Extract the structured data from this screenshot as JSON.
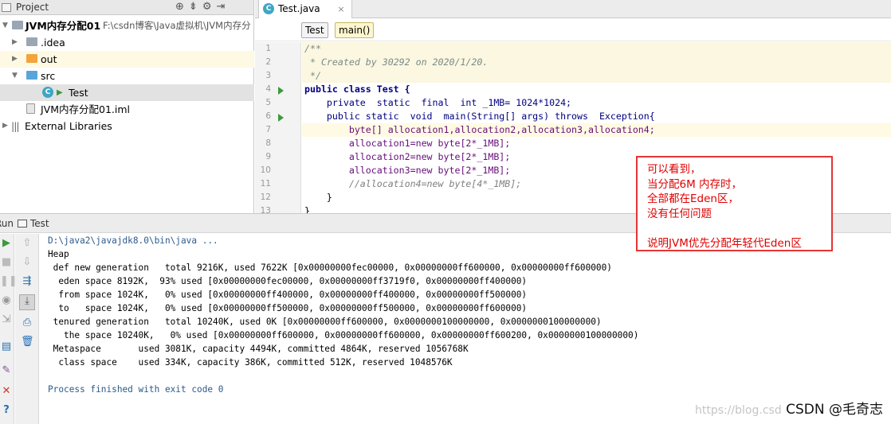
{
  "project_panel": {
    "title": "Project",
    "tree": [
      {
        "label": "JVM内存分配01",
        "path": "F:\\csdn博客\\Java虚拟机\\JVM内存分"
      },
      {
        "label": ".idea"
      },
      {
        "label": "out"
      },
      {
        "label": "src"
      },
      {
        "label": "Test"
      },
      {
        "label": "JVM内存分配01.iml"
      },
      {
        "label": "External Libraries"
      }
    ]
  },
  "editor": {
    "tab": {
      "label": "Test.java"
    },
    "breadcrumbs": [
      "Test",
      "main()"
    ],
    "line_numbers": [
      "1",
      "2",
      "3",
      "4",
      "5",
      "6",
      "7",
      "8",
      "9",
      "10",
      "11",
      "12",
      "13"
    ],
    "lines": [
      "/**",
      " * Created by 30292 on 2020/1/20.",
      " */",
      "public class Test {",
      "    private  static  final  int _1MB= 1024*1024;",
      "    public static  void  main(String[] args) throws  Exception{",
      "        byte[] allocation1,allocation2,allocation3,allocation4;",
      "        allocation1=new byte[2*_1MB];",
      "        allocation2=new byte[2*_1MB];",
      "        allocation3=new byte[2*_1MB];",
      "        //allocation4=new byte[4*_1MB];",
      "    }",
      "}"
    ]
  },
  "annotation": {
    "lines": [
      "可以看到，",
      "当分配6M 内存时，",
      "全部都在Eden区，",
      "没有任何问题",
      "",
      "说明JVM优先分配年轻代Eden区"
    ]
  },
  "run_panel": {
    "label": "Run",
    "tab": "Test"
  },
  "console": {
    "lines": [
      "D:\\java2\\javajdk8.0\\bin\\java ...",
      "Heap",
      " def new generation   total 9216K, used 7622K [0x00000000fec00000, 0x00000000ff600000, 0x00000000ff600000)",
      "  eden space 8192K,  93% used [0x00000000fec00000, 0x00000000ff3719f0, 0x00000000ff400000)",
      "  from space 1024K,   0% used [0x00000000ff400000, 0x00000000ff400000, 0x00000000ff500000)",
      "  to   space 1024K,   0% used [0x00000000ff500000, 0x00000000ff500000, 0x00000000ff600000)",
      " tenured generation   total 10240K, used 0K [0x00000000ff600000, 0x0000000100000000, 0x0000000100000000)",
      "   the space 10240K,   0% used [0x00000000ff600000, 0x00000000ff600000, 0x00000000ff600200, 0x0000000100000000)",
      " Metaspace       used 3081K, capacity 4494K, committed 4864K, reserved 1056768K",
      "  class space    used 334K, capacity 386K, committed 512K, reserved 1048576K",
      "",
      "Process finished with exit code 0"
    ]
  },
  "watermark": {
    "url": "https://blog.csd",
    "text": "CSDN @毛奇志"
  }
}
